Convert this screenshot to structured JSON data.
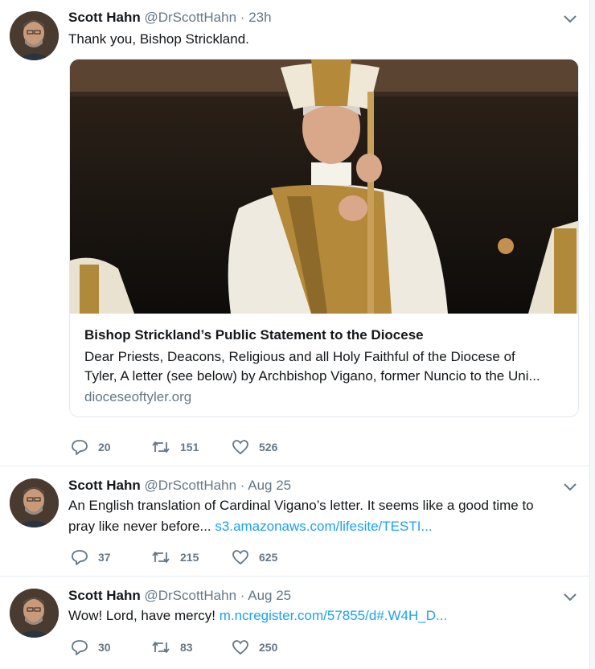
{
  "tweets": [
    {
      "name": "Scott Hahn",
      "handle": "@DrScottHahn",
      "separator": "·",
      "time": "23h",
      "text": "Thank you, Bishop Strickland.",
      "card": {
        "title": "Bishop Strickland’s Public Statement to the Diocese",
        "description_line1": "Dear Priests, Deacons, Religious and all Holy Faithful of the Diocese of",
        "description_line2": "Tyler, A letter (see below) by Archbishop Vigano, former Nuncio to the Uni...",
        "domain": "dioceseoftyler.org",
        "image_icon": "bishop-photo"
      },
      "replies": "20",
      "retweets": "151",
      "likes": "526"
    },
    {
      "name": "Scott Hahn",
      "handle": "@DrScottHahn",
      "separator": "·",
      "time": "Aug 25",
      "text_line1": "An English translation of Cardinal Vigano’s letter. It seems like a good time to",
      "text_line2": "pray like never before...",
      "link": "s3.amazonaws.com/lifesite/TESTI...",
      "replies": "37",
      "retweets": "215",
      "likes": "625"
    },
    {
      "name": "Scott Hahn",
      "handle": "@DrScottHahn",
      "separator": "·",
      "time": "Aug 25",
      "text": "Wow! Lord, have mercy!",
      "link": "m.ncregister.com/57855/d#.W4H_D...",
      "replies": "30",
      "retweets": "83",
      "likes": "250"
    }
  ],
  "icons": {
    "reply": "reply-icon",
    "retweet": "retweet-icon",
    "like": "heart-icon",
    "more": "chevron-down-icon"
  },
  "colors": {
    "link": "#1da1f2",
    "secondary_text": "#657786",
    "border": "#e6ecf0"
  }
}
